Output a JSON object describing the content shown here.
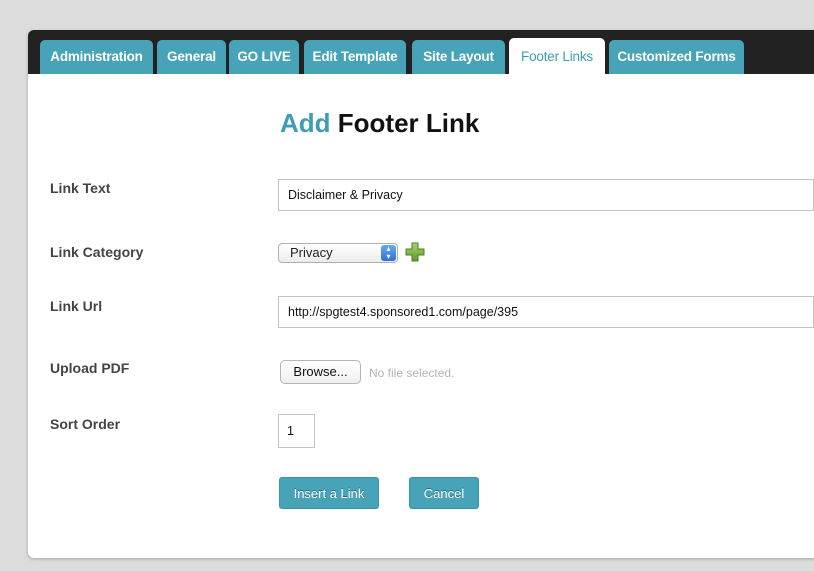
{
  "tabs": [
    {
      "label": "Administration",
      "active": false
    },
    {
      "label": "General",
      "active": false
    },
    {
      "label": "GO LIVE",
      "active": false
    },
    {
      "label": "Edit Template",
      "active": false
    },
    {
      "label": "Site Layout",
      "active": false
    },
    {
      "label": "Footer Links",
      "active": true
    },
    {
      "label": "Customized Forms",
      "active": false
    }
  ],
  "form": {
    "title_accent": "Add",
    "title_rest": "Footer Link",
    "link_text_label": "Link Text",
    "link_text_value": "Disclaimer & Privacy",
    "link_category_label": "Link Category",
    "link_category_value": "Privacy",
    "link_url_label": "Link Url",
    "link_url_value": "http://spgtest4.sponsored1.com/page/395",
    "upload_pdf_label": "Upload PDF",
    "browse_label": "Browse...",
    "no_file_text": "No file selected.",
    "sort_order_label": "Sort Order",
    "sort_order_value": "1",
    "insert_button": "Insert a Link",
    "cancel_button": "Cancel"
  },
  "colors": {
    "accent": "#46a3b8",
    "tabbar": "#222222",
    "add_icon": "#7cb342"
  },
  "icons": {
    "add_category": "plus-icon",
    "select_arrows": "chevron-updown-icon"
  }
}
